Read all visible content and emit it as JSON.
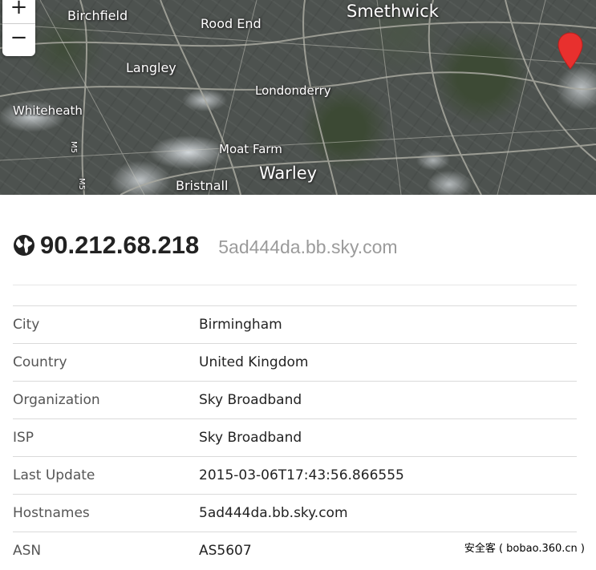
{
  "map": {
    "labels": {
      "birchfield": "Birchfield",
      "rood_end": "Rood End",
      "smethwick": "Smethwick",
      "langley": "Langley",
      "londonderry": "Londonderry",
      "whiteheath": "Whiteheath",
      "moat_farm": "Moat Farm",
      "warley": "Warley",
      "bristnall": "Bristnall",
      "road_m5_a": "M5",
      "road_m5_b": "M5"
    },
    "zoom_in_label": "+",
    "zoom_out_label": "−",
    "marker_icon": "map-pin-icon",
    "marker_color": "#e8302e"
  },
  "host": {
    "icon": "globe-icon",
    "ip": "90.212.68.218",
    "hostname": "5ad444da.bb.sky.com"
  },
  "details": [
    {
      "key": "City",
      "value": "Birmingham"
    },
    {
      "key": "Country",
      "value": "United Kingdom"
    },
    {
      "key": "Organization",
      "value": "Sky Broadband"
    },
    {
      "key": "ISP",
      "value": "Sky Broadband"
    },
    {
      "key": "Last Update",
      "value": "2015-03-06T17:43:56.866555"
    },
    {
      "key": "Hostnames",
      "value": "5ad444da.bb.sky.com"
    },
    {
      "key": "ASN",
      "value": "AS5607"
    }
  ],
  "watermark": "安全客 ( bobao.360.cn )"
}
